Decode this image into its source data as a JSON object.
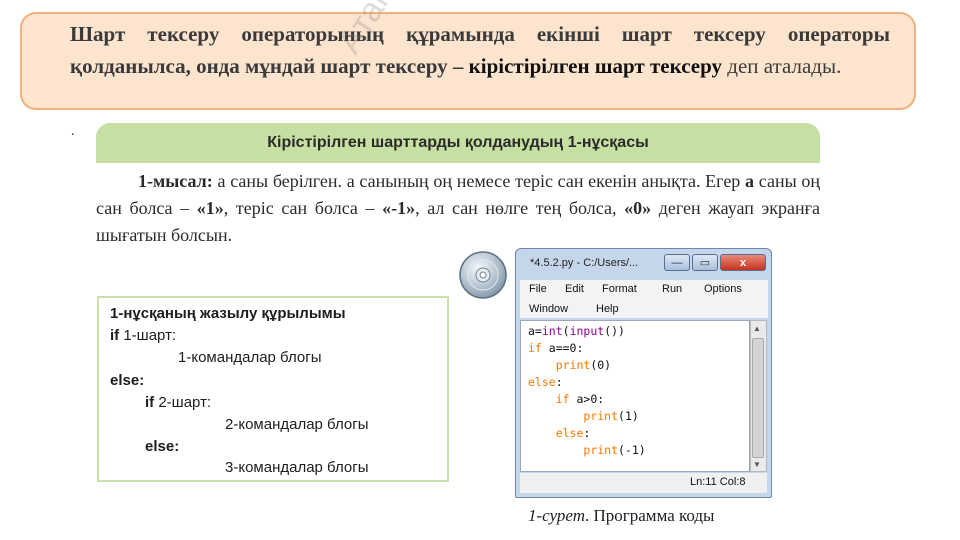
{
  "definition": {
    "text": "Шарт тексеру операторының құрамында екінші шарт тексеру операторы қолданылса, онда мұндай шарт тексеру –",
    "term": "кірістірілген шарт тексеру",
    "rest": " деп аталады."
  },
  "watermark": "Атамұра баспасы",
  "stray_dot": ".",
  "section_title": "Кірістірілген шарттарды қолданудың 1-нұсқасы",
  "example": {
    "label": "1-мысал:",
    "text_1": " a саны берілген. a санының оң немесе теріс сан екенін анықта. Егер ",
    "a_bold": "a",
    "text_2": " саны оң сан болса – ",
    "v1": "«1»",
    "text_3": ", теріс сан болса – ",
    "v2": "«-1»",
    "text_4": ", ал сан нөлге тең болса, ",
    "v3": "«0»",
    "text_5": " деген жауап экранға шығатын болсын."
  },
  "structure": {
    "title": "1-нұсқаның жазылу құрылымы",
    "if1_kw": "if",
    "if1_cond": " 1-шарт:",
    "block1": "1-командалар блогы",
    "else1": "else:",
    "if2_kw": "if",
    "if2_cond": "  2-шарт:",
    "block2": "2-командалар блогы",
    "else2": "else:",
    "block3": "3-командалар блогы"
  },
  "window": {
    "title": "*4.5.2.py - C:/Users/...",
    "btn_min": "—",
    "btn_max": "▭",
    "btn_close": "x",
    "menu": [
      "File",
      "Edit",
      "Format",
      "Run",
      "Options",
      "Window",
      "Help"
    ],
    "code": [
      {
        "indent": "",
        "parts": [
          [
            "pl",
            "a="
          ],
          [
            "bi",
            "int"
          ],
          [
            "pl",
            "("
          ],
          [
            "bi",
            "input"
          ],
          [
            "pl",
            "())"
          ]
        ]
      },
      {
        "indent": "",
        "parts": [
          [
            "kw",
            "if"
          ],
          [
            "pl",
            " a==0:"
          ]
        ]
      },
      {
        "indent": "    ",
        "parts": [
          [
            "kw",
            "print"
          ],
          [
            "pl",
            "(0)"
          ]
        ]
      },
      {
        "indent": "",
        "parts": [
          [
            "kw",
            "else"
          ],
          [
            "pl",
            ":"
          ]
        ]
      },
      {
        "indent": "    ",
        "parts": [
          [
            "kw",
            "if"
          ],
          [
            "pl",
            " a>0:"
          ]
        ]
      },
      {
        "indent": "        ",
        "parts": [
          [
            "kw",
            "print"
          ],
          [
            "pl",
            "(1)"
          ]
        ]
      },
      {
        "indent": "    ",
        "parts": [
          [
            "kw",
            "else"
          ],
          [
            "pl",
            ":"
          ]
        ]
      },
      {
        "indent": "        ",
        "parts": [
          [
            "kw",
            "print"
          ],
          [
            "pl",
            "(-1)"
          ]
        ]
      }
    ],
    "status": "Ln:11  Col:8"
  },
  "caption": {
    "label": "1-сурет",
    "text": ". Программа коды"
  },
  "colors": {
    "definition_bg": "#fce4cf",
    "definition_border": "#f3b27d",
    "banner_bg": "#c6dfa2",
    "code_keyword": "#ff7700",
    "code_builtin": "#900090"
  }
}
